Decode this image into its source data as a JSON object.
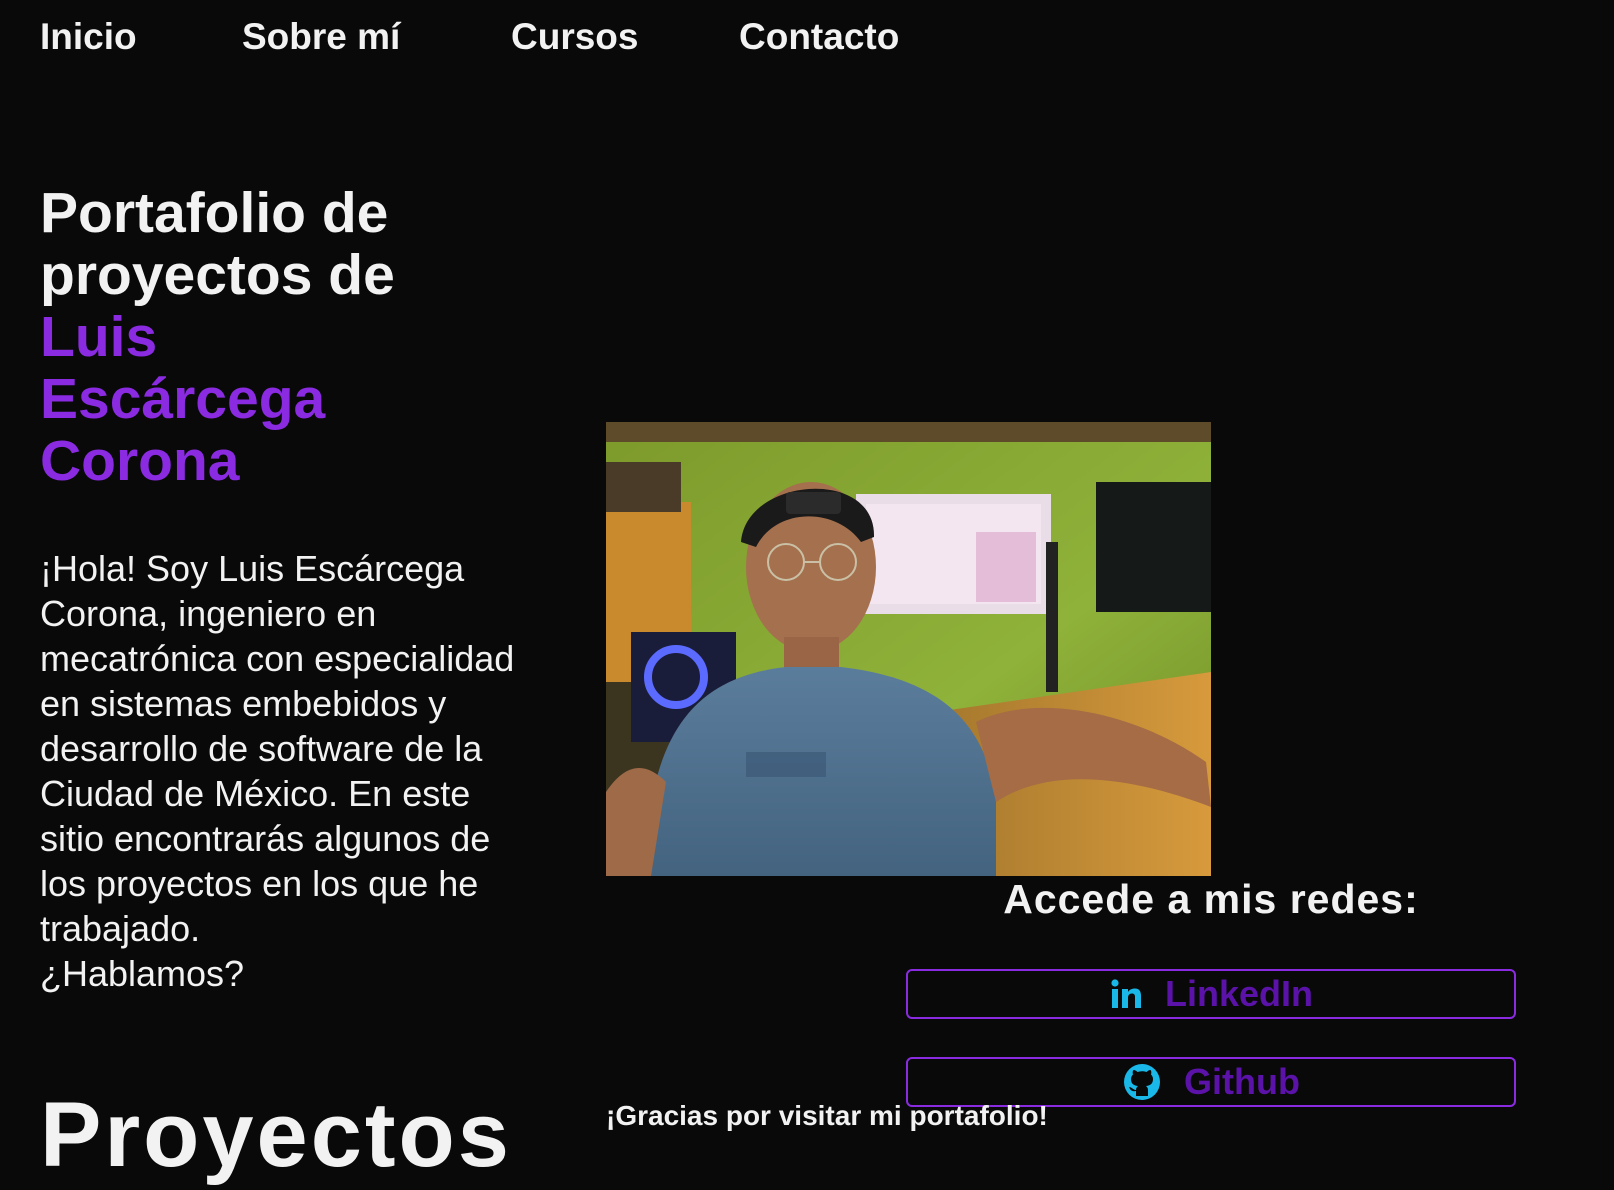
{
  "nav": {
    "items": [
      {
        "label": "Inicio"
      },
      {
        "label": "Sobre mí"
      },
      {
        "label": "Cursos"
      },
      {
        "label": "Contacto"
      }
    ]
  },
  "hero": {
    "title_line1": "Portafolio de",
    "title_line2": "proyectos de",
    "name_line1": "Luis",
    "name_line2": "Escárcega",
    "name_line3": "Corona",
    "intro": "¡Hola! Soy Luis Escárcega Corona, ingeniero en mecatrónica con especialidad en sistemas embebidos y desarrollo de software de la Ciudad de México. En este sitio encontrarás algunos de los proyectos en los que he trabajado.",
    "intro_question": "¿Hablamos?"
  },
  "social": {
    "heading": "Accede a mis redes:",
    "linkedin": {
      "label": "LinkedIn",
      "icon": "linkedin-icon"
    },
    "github": {
      "label": "Github",
      "icon": "github-icon"
    }
  },
  "footer_note": "¡Gracias por visitar mi portafolio!",
  "projects": {
    "heading": "Proyectos"
  },
  "colors": {
    "background": "#090909",
    "text": "#f2f2f2",
    "accent": "#8a2be2",
    "button_text": "#5b12a8",
    "icon": "#1ab8e8"
  }
}
